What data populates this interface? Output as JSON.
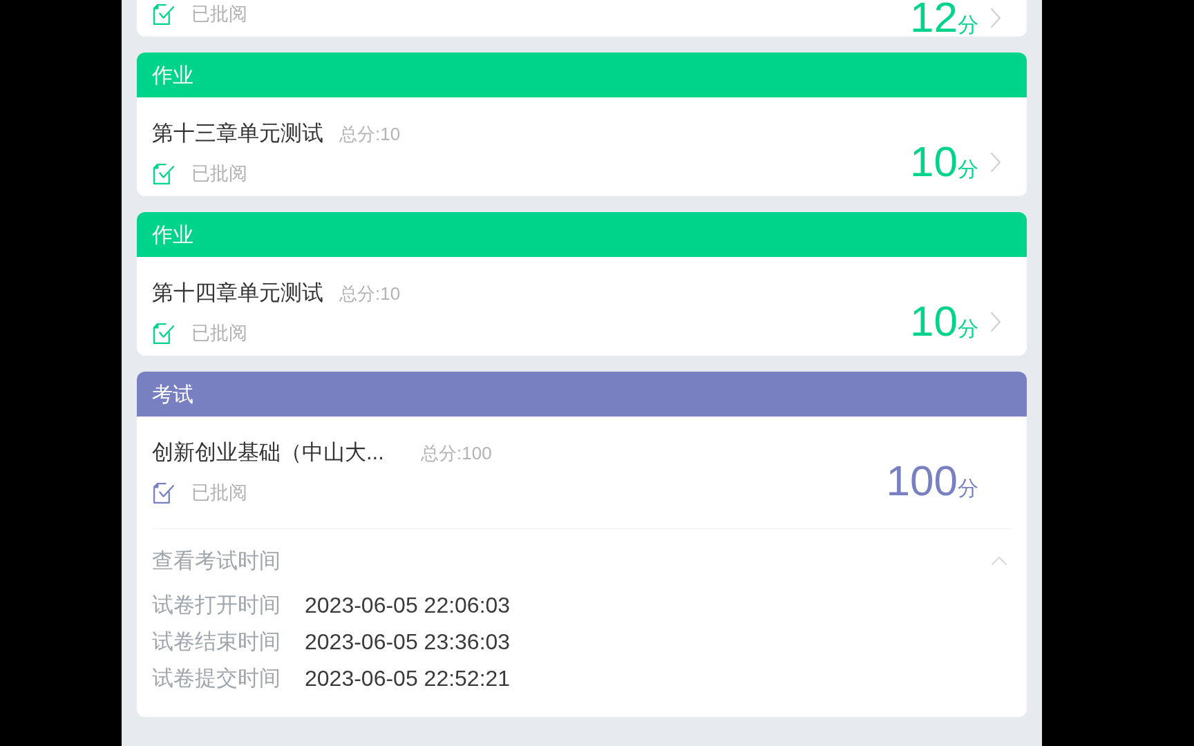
{
  "cards": [
    {
      "kind": "homework",
      "color": "#00d48a",
      "status": "已批阅",
      "score": "12",
      "unit": "分"
    },
    {
      "kind": "homework",
      "color": "#00d48a",
      "category": "作业",
      "title": "第十三章单元测试",
      "total": "总分:10",
      "status": "已批阅",
      "score": "10",
      "unit": "分"
    },
    {
      "kind": "homework",
      "color": "#00d48a",
      "category": "作业",
      "title": "第十四章单元测试",
      "total": "总分:10",
      "status": "已批阅",
      "score": "10",
      "unit": "分"
    },
    {
      "kind": "exam",
      "color": "#7880c2",
      "category": "考试",
      "title": "创新创业基础（中山大...",
      "total": "总分:100",
      "status": "已批阅",
      "score": "100",
      "unit": "分",
      "details": {
        "toggle": "查看考试时间",
        "expanded": true,
        "rows": [
          {
            "label": "试卷打开时间",
            "value": "2023-06-05 22:06:03"
          },
          {
            "label": "试卷结束时间",
            "value": "2023-06-05 23:36:03"
          },
          {
            "label": "试卷提交时间",
            "value": "2023-06-05 22:52:21"
          }
        ]
      }
    }
  ]
}
